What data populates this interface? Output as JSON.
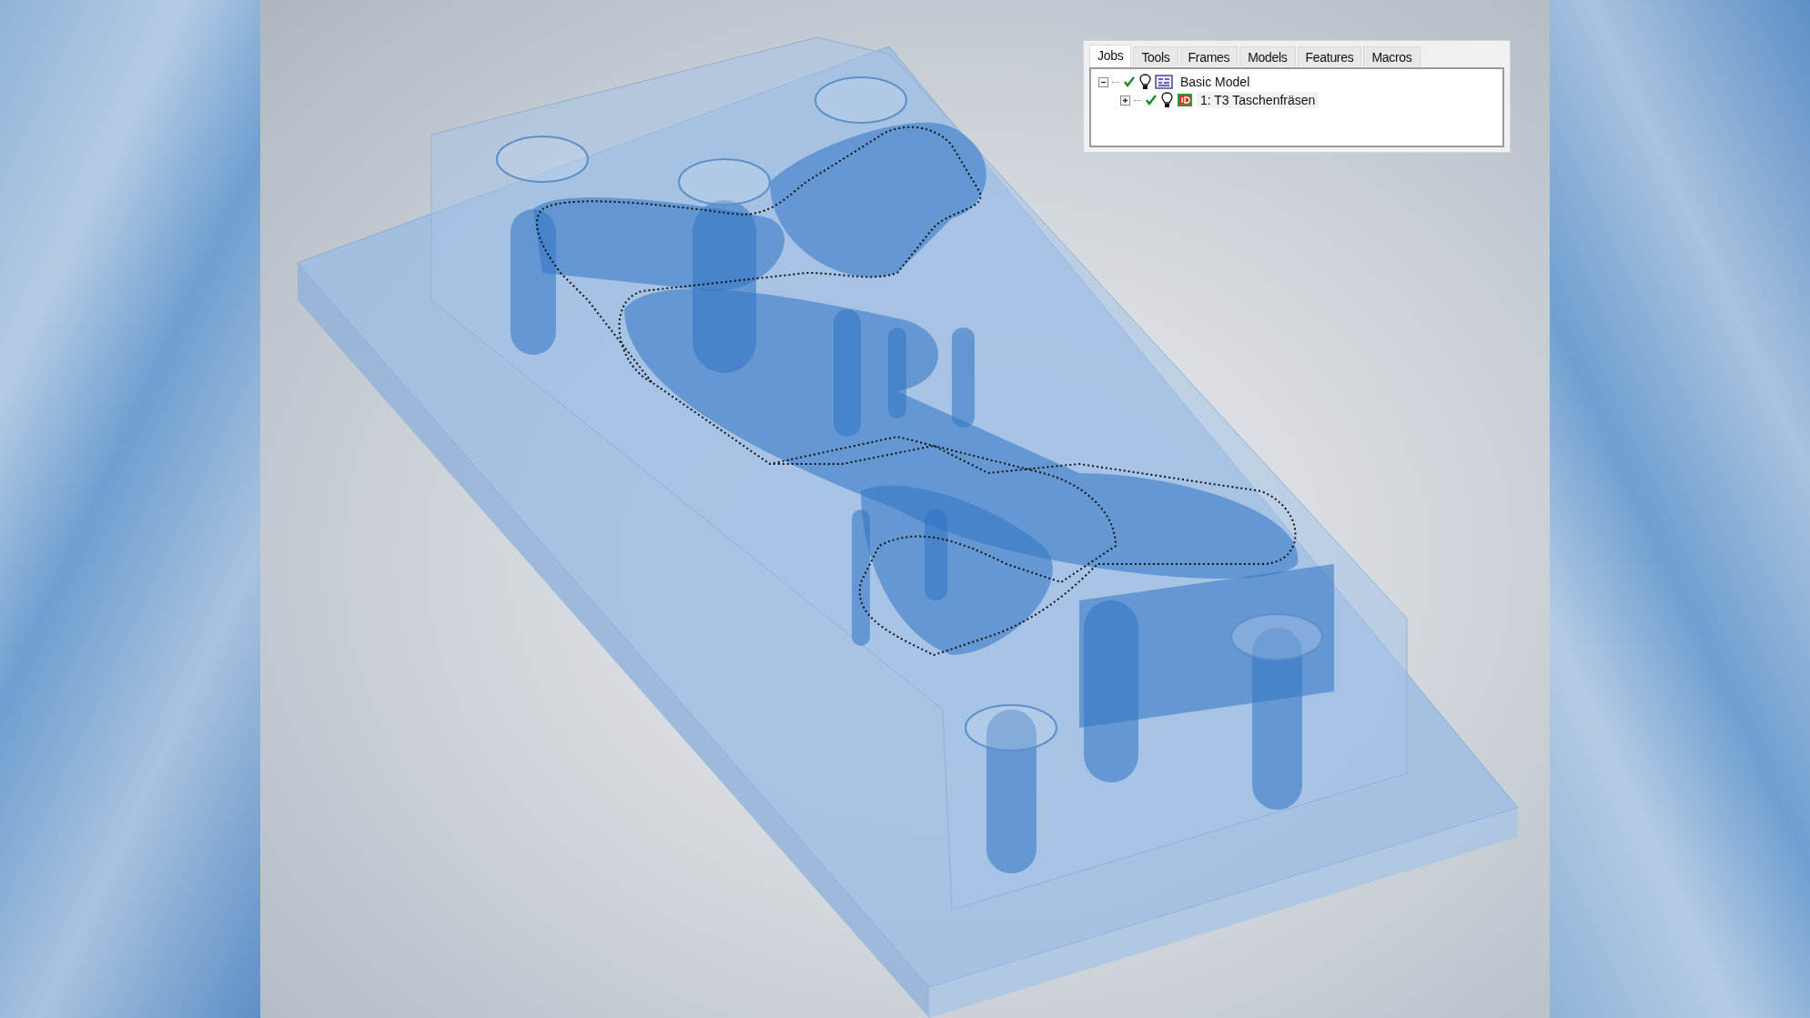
{
  "panel": {
    "tabs": [
      {
        "label": "Jobs",
        "selected": true
      },
      {
        "label": "Tools",
        "selected": false
      },
      {
        "label": "Frames",
        "selected": false
      },
      {
        "label": "Models",
        "selected": false
      },
      {
        "label": "Features",
        "selected": false
      },
      {
        "label": "Macros",
        "selected": false
      }
    ],
    "tree": [
      {
        "label": "Basic Model",
        "kind": "model",
        "expanded": true,
        "checked": true,
        "children": [
          {
            "label": "1: T3 Taschenfräsen",
            "kind": "toolpath",
            "expanded": false,
            "checked": true
          }
        ]
      }
    ]
  }
}
